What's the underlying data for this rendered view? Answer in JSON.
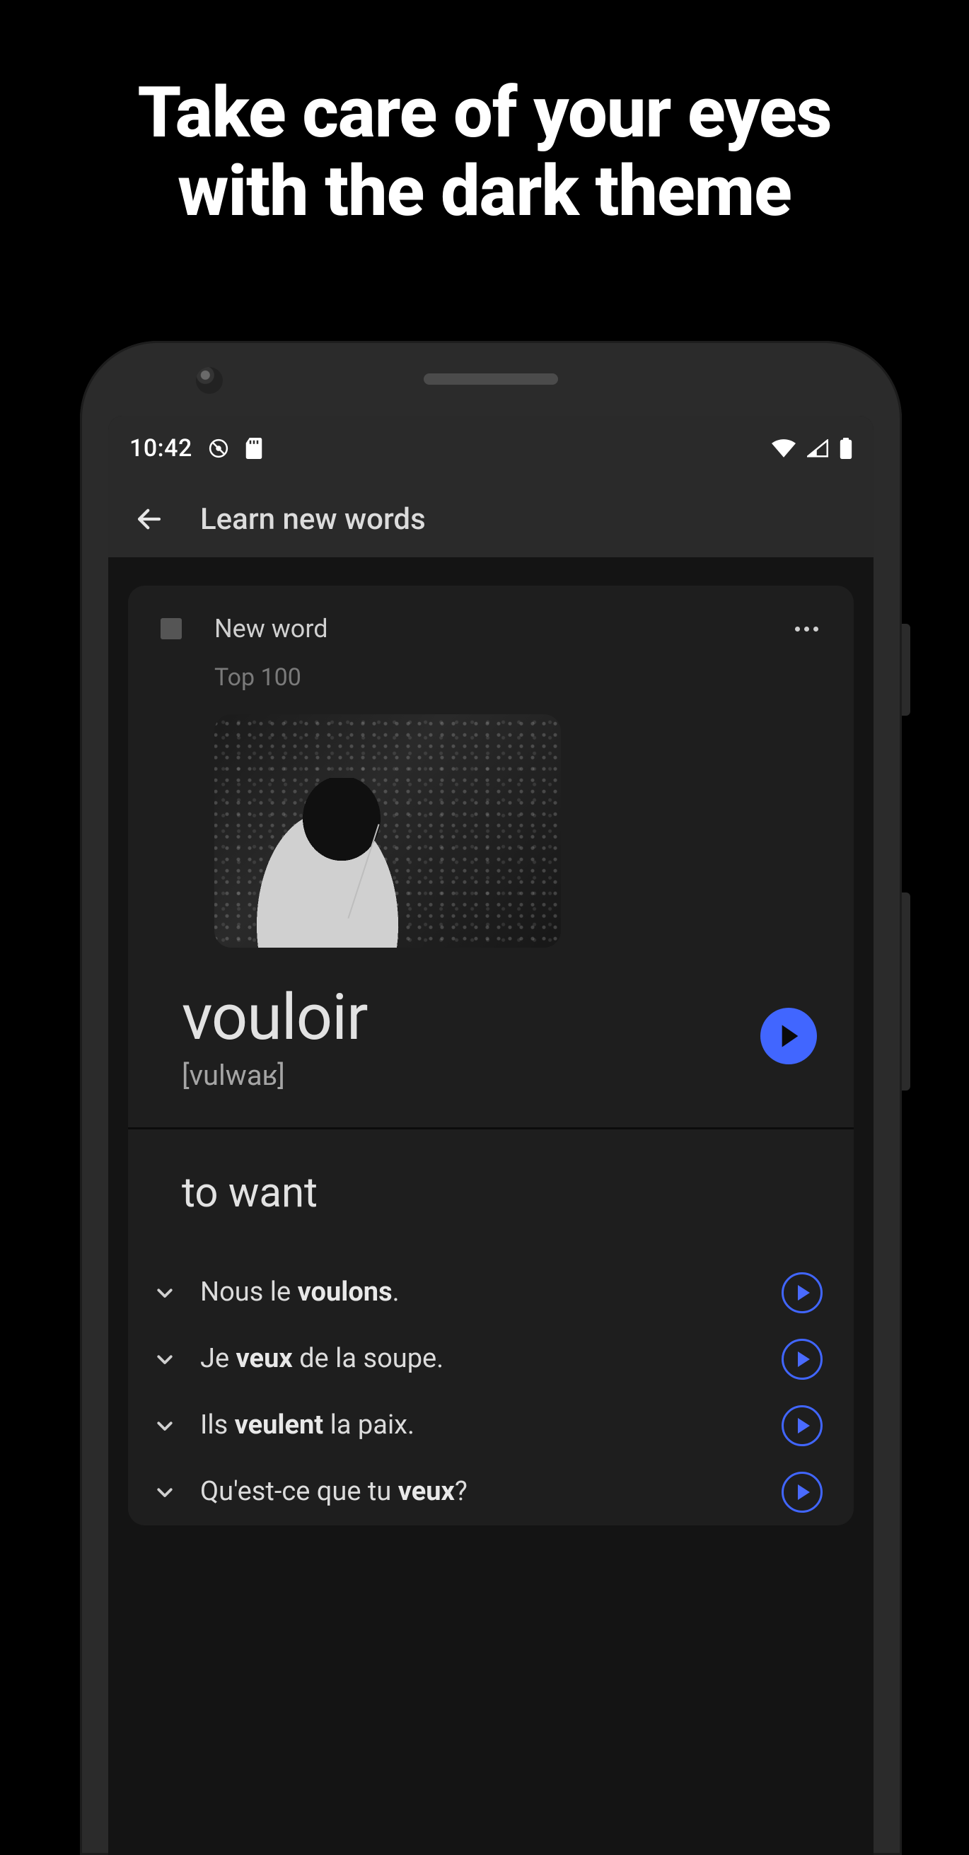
{
  "marketing": {
    "headline": "Take care of your eyes with the dark theme"
  },
  "status_bar": {
    "time": "10:42",
    "icons": [
      "dnd-icon",
      "sd-card-icon",
      "wifi-icon",
      "cell-signal-icon",
      "battery-icon"
    ]
  },
  "app_bar": {
    "title": "Learn new words"
  },
  "card": {
    "label": "New word",
    "collection": "Top 100",
    "image_semantic": "girl-blowing-dandelion-bw",
    "headword": "vouloir",
    "ipa": "[vulwaʁ]",
    "translation": "to want",
    "examples": [
      {
        "pre": "Nous le ",
        "bold": "voulons",
        "post": "."
      },
      {
        "pre": "Je ",
        "bold": "veux",
        "post": " de la soupe."
      },
      {
        "pre": "Ils ",
        "bold": "veulent",
        "post": " la paix."
      },
      {
        "pre": "Qu'est-ce que tu ",
        "bold": "veux",
        "post": "?"
      }
    ]
  },
  "colors": {
    "accent": "#4166ff"
  }
}
